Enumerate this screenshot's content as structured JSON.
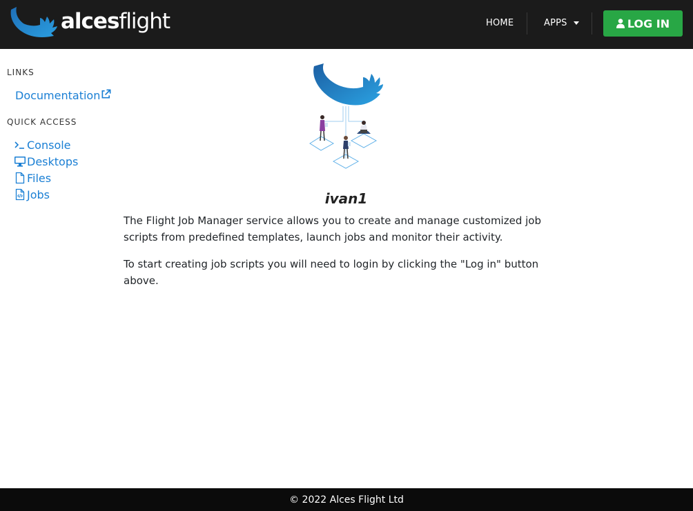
{
  "navbar": {
    "brand_bold": "alces",
    "brand_light": "flight",
    "home_label": "HOME",
    "apps_label": "APPS",
    "login_label": "LOG IN",
    "background": "#1b1b1b",
    "login_color": "#28a745"
  },
  "sidebar": {
    "links_heading": "LINKS",
    "documentation_label": "Documentation",
    "quick_access_heading": "QUICK ACCESS",
    "items": [
      {
        "label": "Console",
        "icon": "terminal-icon"
      },
      {
        "label": "Desktops",
        "icon": "desktop-icon"
      },
      {
        "label": "Files",
        "icon": "file-icon"
      },
      {
        "label": "Jobs",
        "icon": "file-code-icon"
      }
    ],
    "link_color": "#1a7fd4"
  },
  "main": {
    "title": "ivan1",
    "paragraph1": "The Flight Job Manager service allows you to create and manage customized job scripts from predefined templates, launch jobs and monitor their activity.",
    "paragraph2": "To start creating job scripts you will need to login by clicking the \"Log in\" button above."
  },
  "footer": {
    "text": "© 2022 Alces Flight Ltd"
  }
}
